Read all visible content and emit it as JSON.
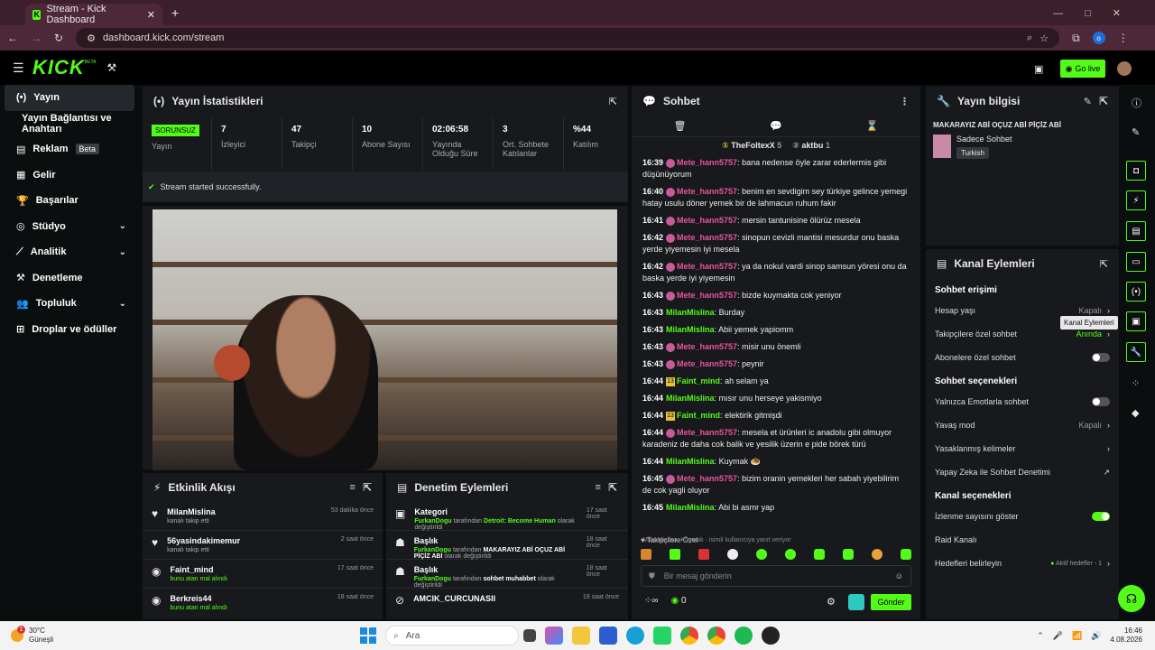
{
  "browser": {
    "tab_title": "Stream - Kick Dashboard",
    "url": "dashboard.kick.com/stream",
    "profile_initial": "o"
  },
  "header": {
    "logo": "KICK",
    "logo_sup": "BETA",
    "go_live": "Go live"
  },
  "sidebar": {
    "items": [
      {
        "label": "Yayın"
      },
      {
        "label": "Yayın Bağlantısı ve Anahtarı"
      },
      {
        "label": "Reklam",
        "badge": "Beta"
      },
      {
        "label": "Gelir"
      },
      {
        "label": "Başarılar"
      },
      {
        "label": "Stüdyo"
      },
      {
        "label": "Analitik"
      },
      {
        "label": "Denetleme"
      },
      {
        "label": "Topluluk"
      },
      {
        "label": "Droplar ve ödüller"
      }
    ]
  },
  "stats": {
    "title": "Yayın İstatistikleri",
    "status": "SORUNSUZ",
    "status_label": "Yayın",
    "items": [
      {
        "value": "7",
        "label": "İzleyici"
      },
      {
        "value": "47",
        "label": "Takipçi"
      },
      {
        "value": "10",
        "label": "Abone Sayısı"
      },
      {
        "value": "02:06:58",
        "label": "Yayında Olduğu Süre"
      },
      {
        "value": "3",
        "label": "Ort. Sohbete Katılanlar"
      },
      {
        "value": "%44",
        "label": "Katılım"
      }
    ],
    "success": "Stream started successfully."
  },
  "activity": {
    "title": "Etkinlik Akışı",
    "rows": [
      {
        "name": "MilanMislina",
        "sub": "kanalı takip etti",
        "time": "53 dakika önce"
      },
      {
        "name": "56yasindakimemur",
        "sub": "kanalı takip etti",
        "time": "2 saat önce"
      },
      {
        "name": "Faint_mind",
        "sub": "bunu atan mal alındı",
        "time": "17 saat önce"
      },
      {
        "name": "Berkreis44",
        "sub": "bunu atan mal alındı",
        "time": "18 saat önce"
      }
    ]
  },
  "moderation": {
    "title": "Denetim Eylemleri",
    "rows": [
      {
        "title": "Kategori",
        "user": "FurkanDogu",
        "mid": "tarafından",
        "target": "Detroit: Become Human",
        "end": "olarak değiştirildi",
        "time": "17 saat önce"
      },
      {
        "title": "Başlık",
        "user": "FurkanDogu",
        "mid": "tarafından",
        "target": "MAKARAYIZ ABİ OÇUZ ABİ PİÇİZ ABİ",
        "end": "olarak değiştirildi",
        "time": "18 saat önce"
      },
      {
        "title": "Başlık",
        "user": "FurkanDogu",
        "mid": "tarafından",
        "target": "sohbet muhabbet",
        "end": "olarak değiştirildi",
        "time": "18 saat önce"
      },
      {
        "title": "AMCIK_CURCUNASII",
        "user": "",
        "mid": "",
        "target": "",
        "end": "",
        "time": "19 saat önce"
      }
    ]
  },
  "chat": {
    "title": "Sohbet",
    "top1": "TheFoltexX",
    "top1_n": "5",
    "top2": "aktbu",
    "top2_n": "1",
    "messages": [
      {
        "t": "16:39",
        "user": "Mete_hann5757",
        "color": "#e8559d",
        "badge": "b",
        "text": "bana nedense öyle zarar ederlermis gibi düşünüyorum"
      },
      {
        "t": "16:40",
        "user": "Mete_hann5757",
        "color": "#e8559d",
        "badge": "b",
        "text": "benim en sevdigim sey türkiye gelince yemegi hatay usulu döner yemek bir de lahmacun ruhum fakir"
      },
      {
        "t": "16:41",
        "user": "Mete_hann5757",
        "color": "#e8559d",
        "badge": "b",
        "text": "mersin tantunisine ölürüz mesela"
      },
      {
        "t": "16:42",
        "user": "Mete_hann5757",
        "color": "#e8559d",
        "badge": "b",
        "text": "sinopun cevizli mantisi mesurdur onu baska yerde yiyemesin iyi mesela"
      },
      {
        "t": "16:42",
        "user": "Mete_hann5757",
        "color": "#e8559d",
        "badge": "b",
        "text": "ya da nokul vardi sinop samsun yöresi onu da baska yerde iyi yiyemesin"
      },
      {
        "t": "16:43",
        "user": "Mete_hann5757",
        "color": "#e8559d",
        "badge": "b",
        "text": "bizde kuymakta cok yeniyor"
      },
      {
        "t": "16:43",
        "user": "MilanMislina",
        "color": "#53fc18",
        "badge": "",
        "text": "Burday"
      },
      {
        "t": "16:43",
        "user": "MilanMislina",
        "color": "#53fc18",
        "badge": "",
        "text": "Abii yemek yapiomm"
      },
      {
        "t": "16:43",
        "user": "Mete_hann5757",
        "color": "#e8559d",
        "badge": "b",
        "text": "misir unu önemli"
      },
      {
        "t": "16:43",
        "user": "Mete_hann5757",
        "color": "#e8559d",
        "badge": "b",
        "text": "peynir"
      },
      {
        "t": "16:44",
        "user": "Faint_mind",
        "color": "#53fc18",
        "badge": "13",
        "text": "ah selam ya"
      },
      {
        "t": "16:44",
        "user": "MilanMislina",
        "color": "#53fc18",
        "badge": "",
        "text": "mısır unu herseye yakismiyo"
      },
      {
        "t": "16:44",
        "user": "Faint_mind",
        "color": "#53fc18",
        "badge": "13",
        "text": "elektirik gitmişdi"
      },
      {
        "t": "16:44",
        "user": "Mete_hann5757",
        "color": "#e8559d",
        "badge": "b",
        "text": "mesela et ürünleri ic anadolu gibi olmuyor karadeniz de daha cok balik ve yesilik üzerin e pide börek türü"
      },
      {
        "t": "16:44",
        "user": "MilanMislina",
        "color": "#53fc18",
        "badge": "",
        "text": "Kuymak 🧆"
      },
      {
        "t": "16:45",
        "user": "Mete_hann5757",
        "color": "#e8559d",
        "badge": "b",
        "text": "bizim oranin yemekleri her sabah yiyebilirim de cok yagli oluyor"
      },
      {
        "t": "16:45",
        "user": "MilanMislina",
        "color": "#53fc18",
        "badge": "",
        "text": "Abi bi asmr yap"
      }
    ],
    "reply_note": "MilanMislina: Kuymak · isimli kullanıcıya yanıt veriyor",
    "followers_only": "Takipçilere Özel",
    "input_placeholder": "Bir mesaj gönderin",
    "count": "0",
    "send": "Gönder"
  },
  "stream_info": {
    "title": "Yayın bilgisi",
    "stream_title": "MAKARAYIZ ABİ OÇUZ ABİ PİÇİZ ABİ",
    "category": "Sadece Sohbet",
    "language": "Turkish"
  },
  "channel_actions": {
    "title": "Kanal Eylemleri",
    "tooltip": "Kanal Eylemleri",
    "chat_access": "Sohbet erişimi",
    "account_age": "Hesap yaşı",
    "account_age_val": "Kapalı",
    "followers_chat": "Takipçilere özel sohbet",
    "followers_chat_val": "Anında",
    "subs_chat": "Abonelere özel sohbet",
    "chat_options": "Sohbet seçenekleri",
    "emote_only": "Yalnızca Emotlarla sohbet",
    "slow_mode": "Yavaş mod",
    "slow_mode_val": "Kapalı",
    "banned_words": "Yasaklanmış kelimeler",
    "ai_mod": "Yapay Zeka ile Sohbet Denetimi",
    "channel_options": "Kanal seçenekleri",
    "show_viewers": "İzlenme sayısını göster",
    "raid": "Raid Kanalı",
    "goals": "Hedefleri belirleyin",
    "goals_val": "Aktif hedefler - 1"
  },
  "taskbar": {
    "temp": "30°C",
    "weather": "Güneşli",
    "search": "Ara",
    "time": "16:46",
    "date": "4.08.2026",
    "notif": "1"
  }
}
